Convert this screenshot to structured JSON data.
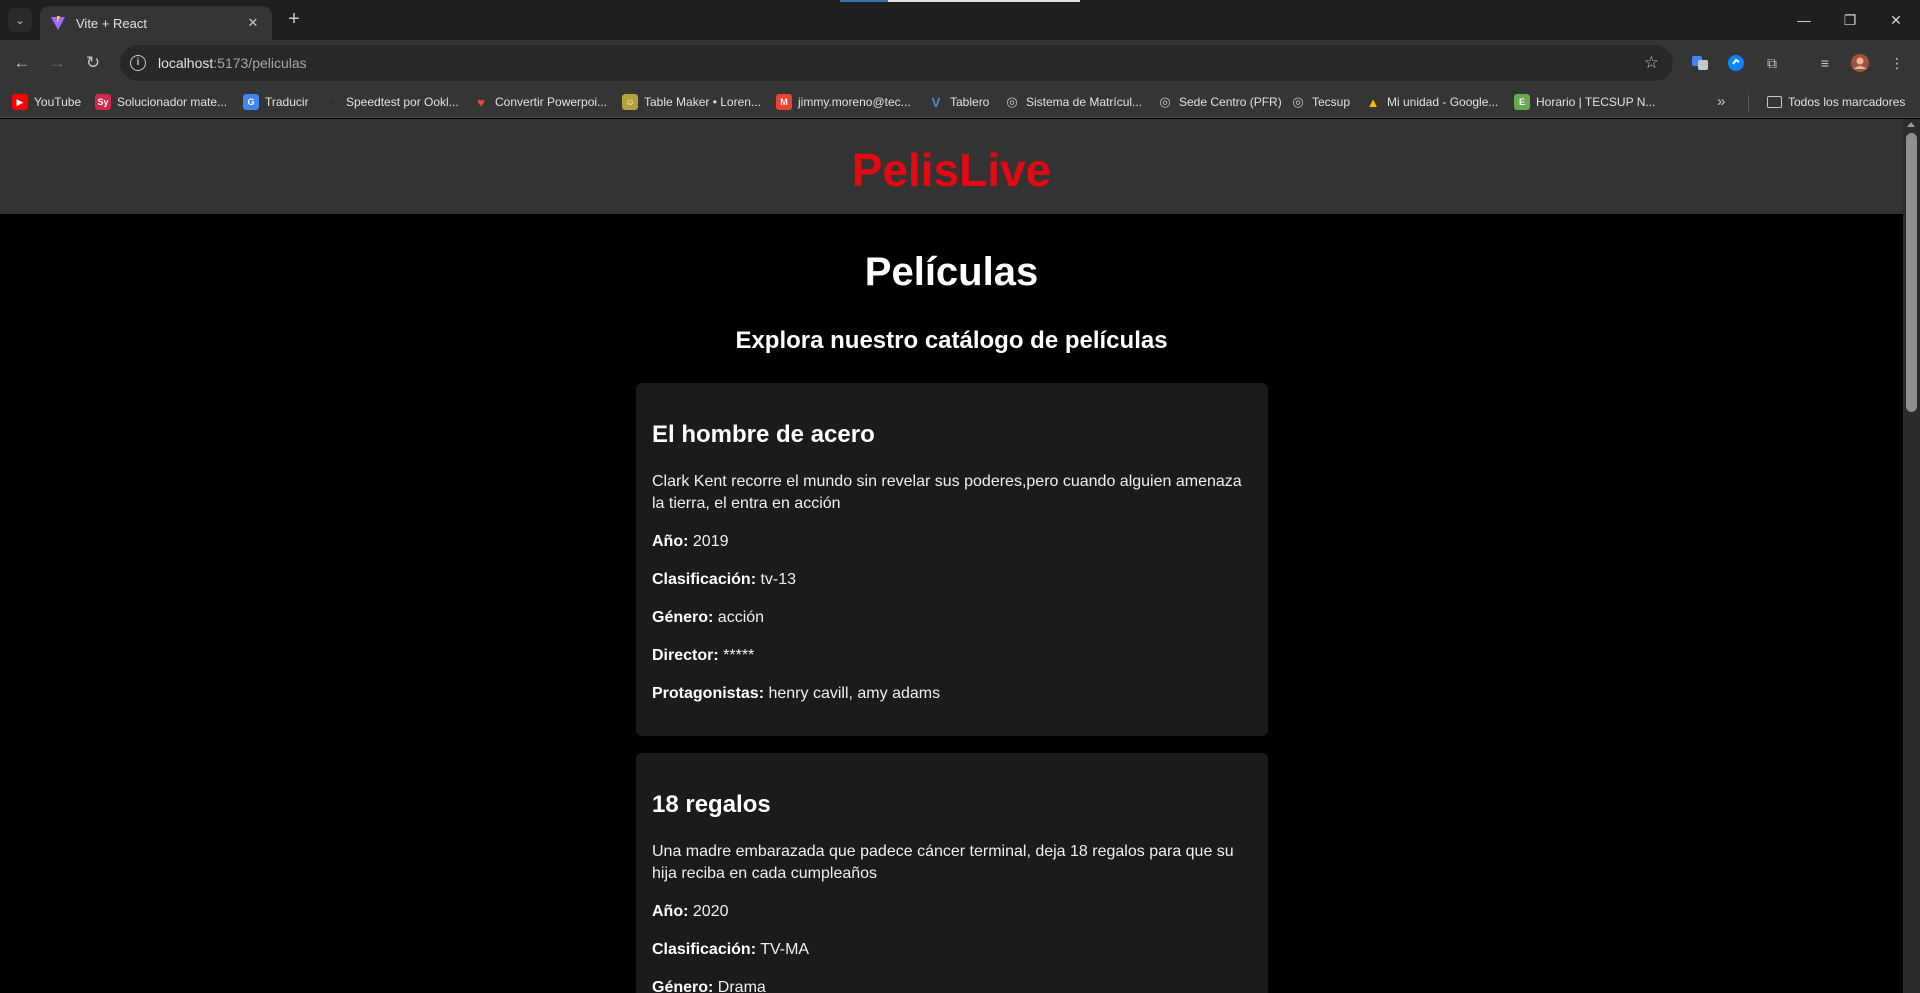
{
  "browser": {
    "tab_title": "Vite + React",
    "url_host": "localhost",
    "url_path": ":5173/peliculas",
    "bookmarks": [
      {
        "label": "YouTube",
        "icon": "youtube-icon",
        "color": "#ff0000"
      },
      {
        "label": "Solucionador mate...",
        "icon": "symbolab-icon",
        "color": "#d3264a"
      },
      {
        "label": "Traducir",
        "icon": "translate-icon",
        "color": "#4285f4"
      },
      {
        "label": "Speedtest por Ookl...",
        "icon": "speedtest-icon",
        "color": "#2b2b2b"
      },
      {
        "label": "Convertir Powerpoi...",
        "icon": "heart-icon",
        "color": "#e2483c"
      },
      {
        "label": "Table Maker • Loren...",
        "icon": "table-maker-icon",
        "color": "#b5a13a"
      },
      {
        "label": "jimmy.moreno@tec...",
        "icon": "gmail-icon",
        "color": "#ea4335"
      },
      {
        "label": "Tablero",
        "icon": "tablero-icon",
        "color": "#4a90d9"
      },
      {
        "label": "Sistema de Matrícul...",
        "icon": "globe-icon",
        "color": "#c7c7c7"
      },
      {
        "label": "Sede Centro (PFR)",
        "icon": "globe-icon",
        "color": "#c7c7c7"
      },
      {
        "label": "Tecsup",
        "icon": "globe-icon",
        "color": "#c7c7c7"
      },
      {
        "label": "Mi unidad - Google...",
        "icon": "drive-icon",
        "color": "#fbbc04"
      },
      {
        "label": "Horario | TECSUP N...",
        "icon": "sheets-icon",
        "color": "#6aa84f"
      }
    ],
    "all_bookmarks_label": "Todos los marcadores"
  },
  "site": {
    "logo": "PelisLive",
    "page_title": "Películas",
    "page_subtitle": "Explora nuestro catálogo de películas",
    "labels": {
      "year": "Año:",
      "rating": "Clasificación:",
      "genre": "Género:",
      "director": "Director:",
      "cast": "Protagonistas:"
    },
    "movies": [
      {
        "title": "El hombre de acero",
        "description": "Clark Kent recorre el mundo sin revelar sus poderes,pero cuando alguien amenaza la tierra, el entra en acción",
        "year": "2019",
        "rating": "tv-13",
        "genre": "acción",
        "director": "*****",
        "cast": "henry cavill, amy adams"
      },
      {
        "title": "18 regalos",
        "description": "Una madre embarazada que padece cáncer terminal, deja 18 regalos para que su hija reciba en cada cumpleaños",
        "year": "2020",
        "rating": "TV-MA",
        "genre": "Drama"
      }
    ]
  }
}
